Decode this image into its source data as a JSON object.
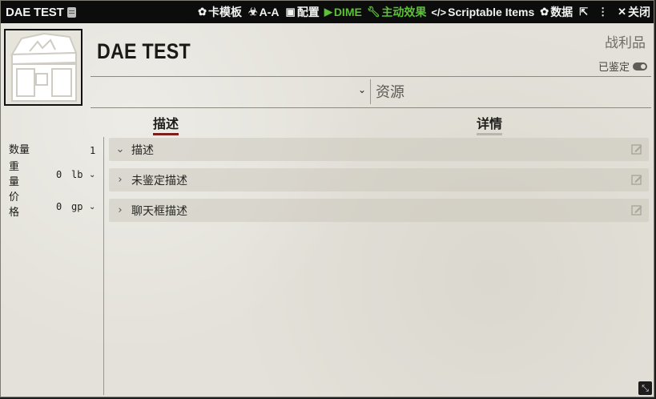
{
  "window": {
    "title": "DAE TEST",
    "buttons": [
      {
        "icon": "gear-icon",
        "label": "卡模板"
      },
      {
        "icon": "biohazard-icon",
        "label": "A-A"
      },
      {
        "icon": "box-open-icon",
        "label": "配置"
      },
      {
        "icon": "dime-icon",
        "label": "DIME"
      },
      {
        "icon": "wrench-icon",
        "label": "主动效果"
      },
      {
        "icon": "code-icon",
        "label": "Scriptable Items"
      },
      {
        "icon": "gear-icon",
        "label": "数据"
      }
    ],
    "close_label": "关闭"
  },
  "item": {
    "name": "DAE TEST",
    "type": "战利品",
    "identified_label": "已鉴定",
    "resource_label": "资源"
  },
  "tabs": {
    "description": "描述",
    "details": "详情"
  },
  "properties": {
    "quantity_label": "数量",
    "quantity_value": "1",
    "weight_label_1": "重",
    "weight_label_2": "量",
    "weight_value": "0",
    "weight_unit": "lb",
    "price_label_1": "价",
    "price_label_2": "格",
    "price_value": "0",
    "price_unit": "gp"
  },
  "sections": [
    {
      "label": "描述",
      "expanded": true
    },
    {
      "label": "未鉴定描述",
      "expanded": false
    },
    {
      "label": "聊天框描述",
      "expanded": false
    }
  ],
  "colors": {
    "accent": "#7b1f1a",
    "active_green": "#5bc236",
    "header_bg": "#0c0c0c",
    "sheet_bg": "#e3e1d9"
  }
}
